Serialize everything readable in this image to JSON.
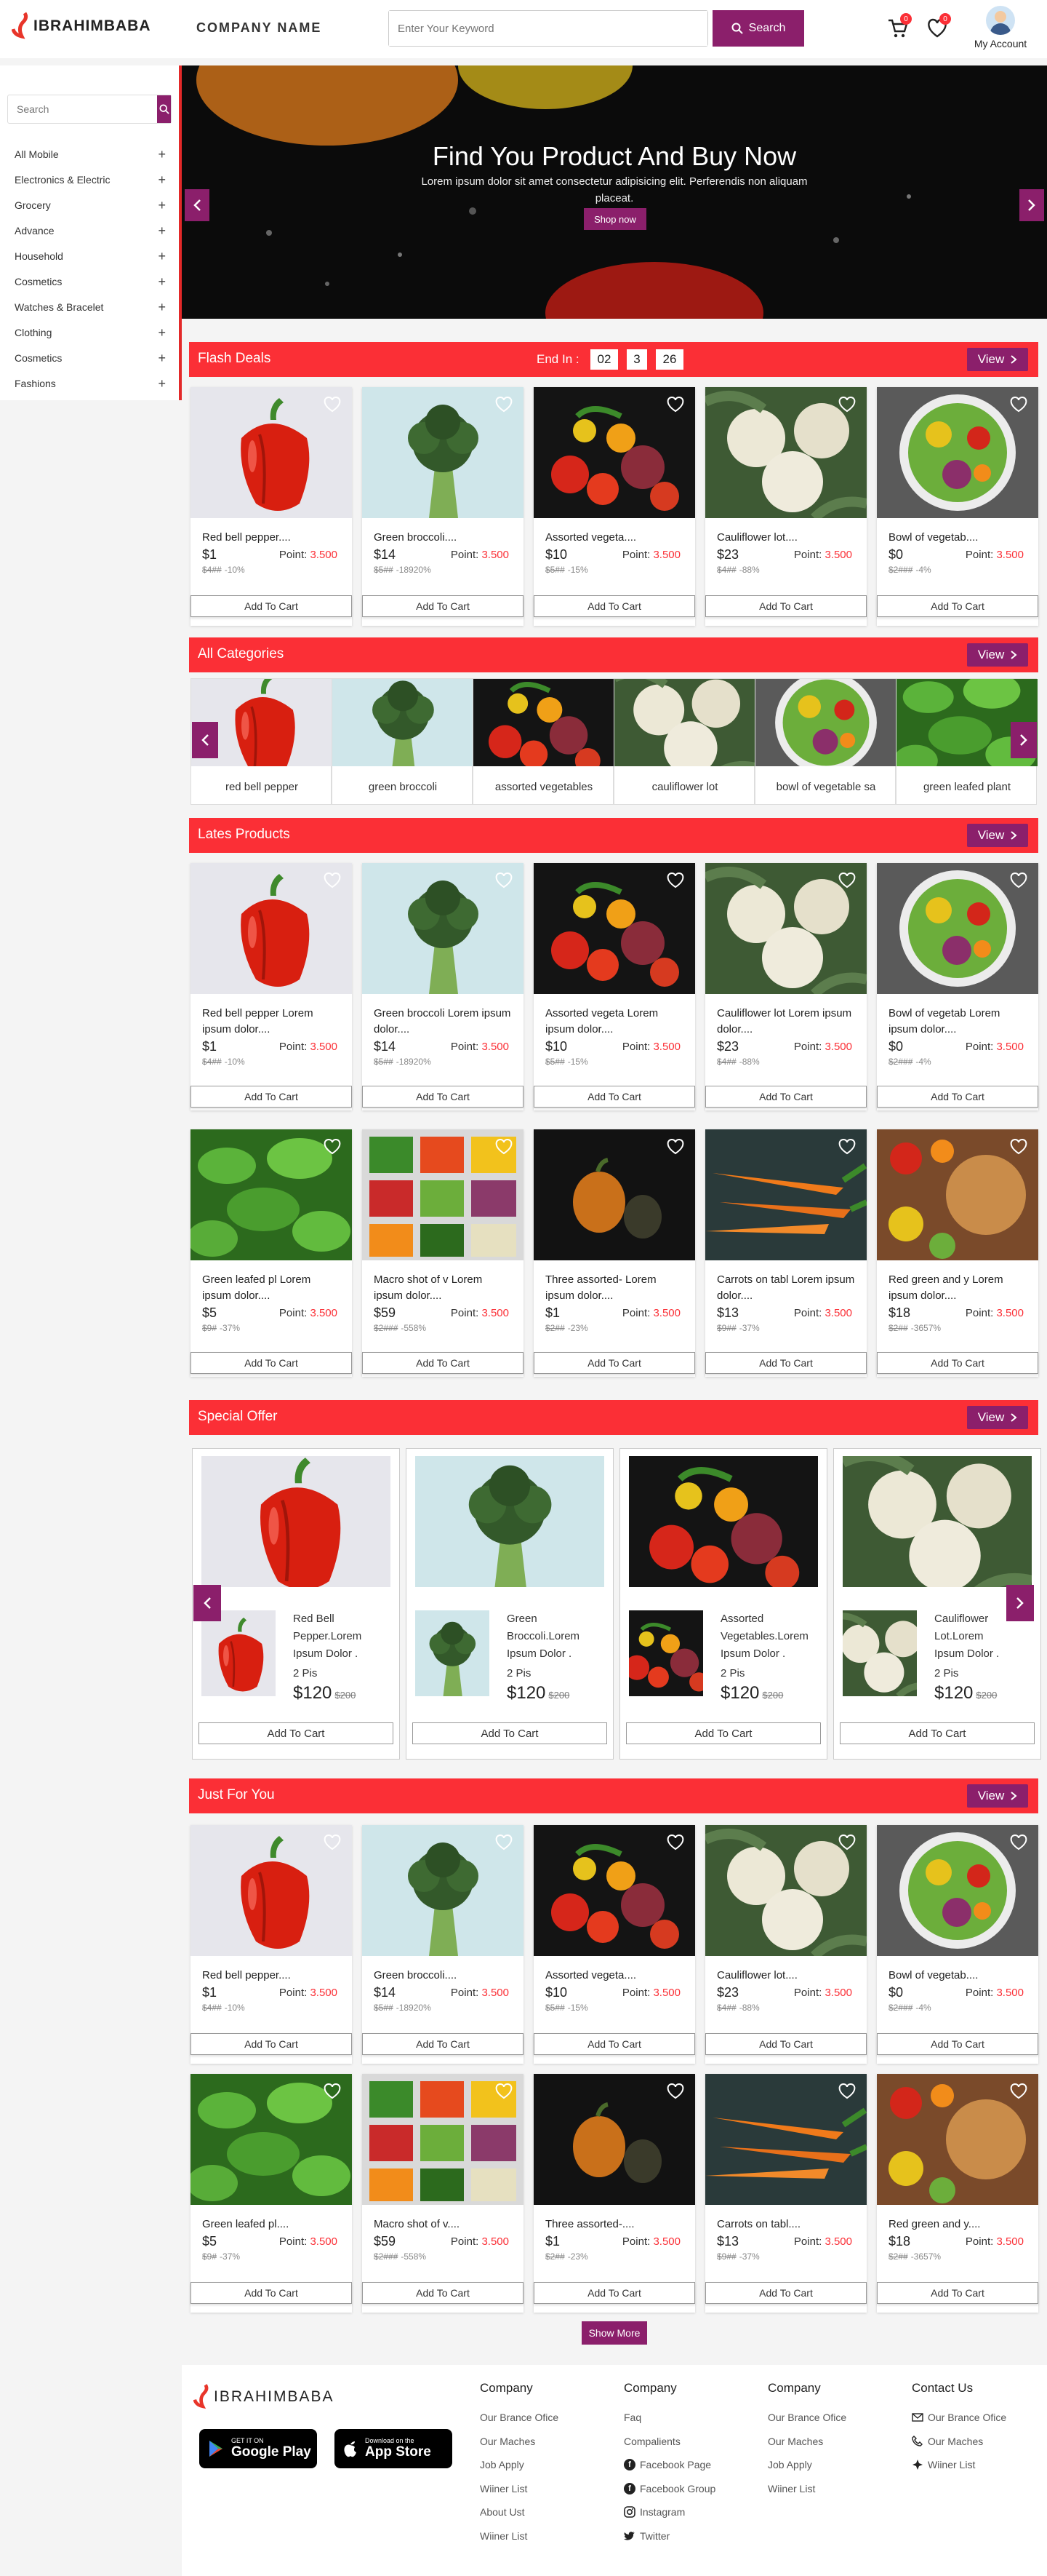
{
  "header": {
    "brand": "IBRAHIMBABA",
    "company": "COMPANY NAME",
    "search_placeholder": "Enter Your Keyword",
    "search_button": "Search",
    "cart_count": "0",
    "wish_count": "0",
    "account_label": "My Account"
  },
  "sidebar": {
    "search_placeholder": "Search",
    "categories": [
      "All Mobile",
      "Electronics & Electric",
      "Grocery",
      "Advance",
      "Household",
      "Cosmetics",
      "Watches & Bracelet",
      "Clothing",
      "Cosmetics",
      "Fashions"
    ]
  },
  "hero": {
    "title": "Find You Product And Buy Now",
    "subtitle": "Lorem ipsum dolor sit amet consectetur adipisicing elit. Perferendis non aliquam placeat.",
    "button": "Shop now"
  },
  "flash": {
    "title": "Flash Deals",
    "ends_label": "End In :",
    "timer": [
      "02",
      "3",
      "26"
    ],
    "view": "View"
  },
  "labels": {
    "point": "Point:",
    "add_to_cart": "Add To Cart",
    "view": "View",
    "show_more": "Show More"
  },
  "products_short": [
    {
      "name": "Red bell pepper....",
      "price": "$1",
      "point": "3.500",
      "old": "$4##",
      "discount": "-10%"
    },
    {
      "name": "Green broccoli....",
      "price": "$14",
      "point": "3.500",
      "old": "$5##",
      "discount": "-18920%"
    },
    {
      "name": "Assorted vegeta....",
      "price": "$10",
      "point": "3.500",
      "old": "$5##",
      "discount": "-15%"
    },
    {
      "name": "Cauliflower lot....",
      "price": "$23",
      "point": "3.500",
      "old": "$4##",
      "discount": "-88%"
    },
    {
      "name": "Bowl of vegetab....",
      "price": "$0",
      "point": "3.500",
      "old": "$2###",
      "discount": "-4%"
    }
  ],
  "products_long": [
    {
      "name": "Red bell pepper Lorem ipsum dolor....",
      "price": "$1",
      "point": "3.500",
      "old": "$4##",
      "discount": "-10%"
    },
    {
      "name": "Green broccoli Lorem ipsum dolor....",
      "price": "$14",
      "point": "3.500",
      "old": "$5##",
      "discount": "-18920%"
    },
    {
      "name": "Assorted vegeta Lorem ipsum dolor....",
      "price": "$10",
      "point": "3.500",
      "old": "$5##",
      "discount": "-15%"
    },
    {
      "name": "Cauliflower lot Lorem ipsum dolor....",
      "price": "$23",
      "point": "3.500",
      "old": "$4##",
      "discount": "-88%"
    },
    {
      "name": "Bowl of vegetab Lorem ipsum dolor....",
      "price": "$0",
      "point": "3.500",
      "old": "$2###",
      "discount": "-4%"
    }
  ],
  "products_long2": [
    {
      "name": "Green leafed pl Lorem ipsum dolor....",
      "price": "$5",
      "point": "3.500",
      "old": "$9#",
      "discount": "-37%"
    },
    {
      "name": "Macro shot of v Lorem ipsum dolor....",
      "price": "$59",
      "point": "3.500",
      "old": "$2###",
      "discount": "-558%"
    },
    {
      "name": "Three assorted- Lorem ipsum dolor....",
      "price": "$1",
      "point": "3.500",
      "old": "$2##",
      "discount": "-23%"
    },
    {
      "name": "Carrots on tabl Lorem ipsum dolor....",
      "price": "$13",
      "point": "3.500",
      "old": "$9##",
      "discount": "-37%"
    },
    {
      "name": "Red green and y Lorem ipsum dolor....",
      "price": "$18",
      "point": "3.500",
      "old": "$2##",
      "discount": "-3657%"
    }
  ],
  "products_short2": [
    {
      "name": "Green leafed pl....",
      "price": "$5",
      "point": "3.500",
      "old": "$9#",
      "discount": "-37%"
    },
    {
      "name": "Macro shot of v....",
      "price": "$59",
      "point": "3.500",
      "old": "$2###",
      "discount": "-558%"
    },
    {
      "name": "Three assorted-....",
      "price": "$1",
      "point": "3.500",
      "old": "$2##",
      "discount": "-23%"
    },
    {
      "name": "Carrots on tabl....",
      "price": "$13",
      "point": "3.500",
      "old": "$9##",
      "discount": "-37%"
    },
    {
      "name": "Red green and y....",
      "price": "$18",
      "point": "3.500",
      "old": "$2##",
      "discount": "-3657%"
    }
  ],
  "categories_section": {
    "title": "All Categories",
    "items": [
      "red bell pepper",
      "green broccoli",
      "assorted vegetables",
      "cauliflower lot",
      "bowl of vegetable sa",
      "green leafed plant"
    ]
  },
  "latest": {
    "title": "Lates Products"
  },
  "special": {
    "title": "Special Offer",
    "items": [
      {
        "name": "Red Bell Pepper.Lorem Ipsum Dolor .",
        "qty": "2 Pis",
        "price": "$120",
        "old": "$200"
      },
      {
        "name": "Green Broccoli.Lorem Ipsum Dolor .",
        "qty": "2 Pis",
        "price": "$120",
        "old": "$200"
      },
      {
        "name": "Assorted Vegetables.Lorem Ipsum Dolor .",
        "qty": "2 Pis",
        "price": "$120",
        "old": "$200"
      },
      {
        "name": "Cauliflower Lot.Lorem Ipsum Dolor .",
        "qty": "2 Pis",
        "price": "$120",
        "old": "$200"
      }
    ]
  },
  "just": {
    "title": "Just For You"
  },
  "footer": {
    "brand": "IBRAHIMBABA",
    "google_small": "GET IT ON",
    "google_big": "Google Play",
    "apple_small": "Download on the",
    "apple_big": "App Store",
    "col1": {
      "title": "Company",
      "links": [
        "Our Brance Ofice",
        "Our Maches",
        "Job Apply",
        "Wiiner List",
        "About Ust",
        "Wiiner List"
      ]
    },
    "col2": {
      "title": "Company",
      "links": [
        "Faq",
        "Compalients",
        "Facebook Page",
        "Facebook Group",
        "Instagram",
        "Twitter"
      ]
    },
    "col3": {
      "title": "Company",
      "links": [
        "Our Brance Ofice",
        "Our Maches",
        "Job Apply",
        "Wiiner List"
      ]
    },
    "col4": {
      "title": "Contact Us",
      "links": [
        "Our Brance Ofice",
        "Our Maches",
        "Wiiner List"
      ]
    }
  },
  "colors": {
    "accent": "#8b1f6b",
    "red": "#fb2f36"
  }
}
